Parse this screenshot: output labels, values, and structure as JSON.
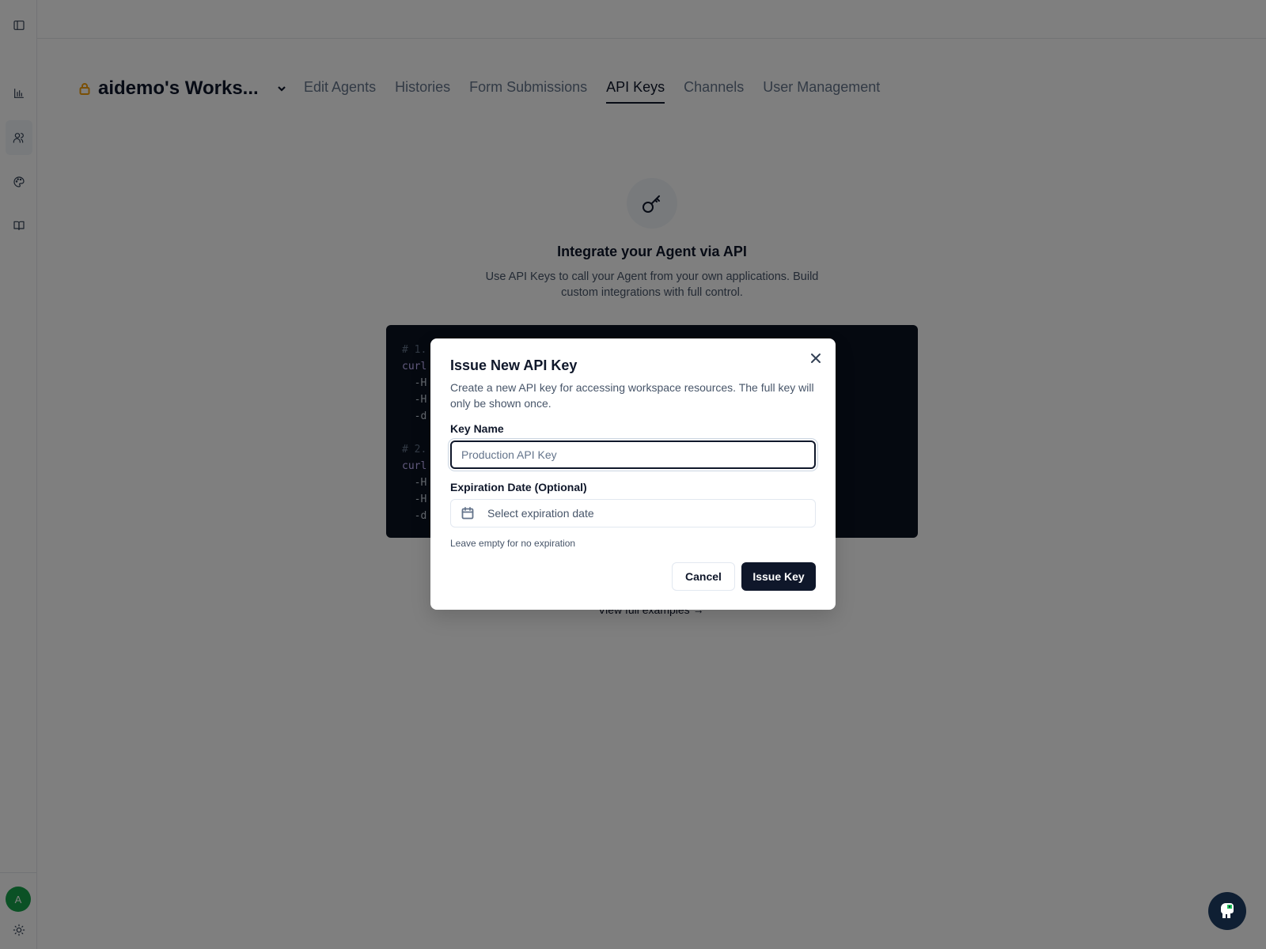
{
  "workspace": {
    "name": "aidemo's Works..."
  },
  "tabs": [
    {
      "label": "Edit Agents"
    },
    {
      "label": "Histories"
    },
    {
      "label": "Form Submissions"
    },
    {
      "label": "API Keys"
    },
    {
      "label": "Channels"
    },
    {
      "label": "User Management"
    }
  ],
  "active_tab": "API Keys",
  "hero": {
    "title": "Integrate your Agent via API",
    "subtitle": "Use API Keys to call your Agent from your own applications. Build custom integrations with full control."
  },
  "code_lines": [
    "# 1.",
    "curl",
    "  -H",
    "  -H",
    "  -d",
    "",
    "# 2.",
    "curl",
    "  -H",
    "  -H",
    "  -d"
  ],
  "full_examples_link": "View full examples →",
  "user": {
    "avatar_initial": "A"
  },
  "dialog": {
    "title": "Issue New API Key",
    "description": "Create a new API key for accessing workspace resources. The full key will only be shown once.",
    "key_name_label": "Key Name",
    "key_name_placeholder": "Production API Key",
    "key_name_value": "",
    "expiration_label": "Expiration Date (Optional)",
    "expiration_placeholder": "Select expiration date",
    "expiration_hint": "Leave empty for no expiration",
    "cancel_label": "Cancel",
    "issue_label": "Issue Key"
  },
  "icons": {
    "sidebar_toggle": "panel-left-icon",
    "analytics": "bar-chart-icon",
    "agents": "users-icon",
    "appearance": "palette-icon",
    "docs": "book-open-icon",
    "theme": "sun-icon",
    "workspace_lock": "lock-icon",
    "hero": "key-icon"
  },
  "colors": {
    "primary": "#0f172a",
    "lock": "#f59e0b",
    "avatar": "#16a34a"
  }
}
